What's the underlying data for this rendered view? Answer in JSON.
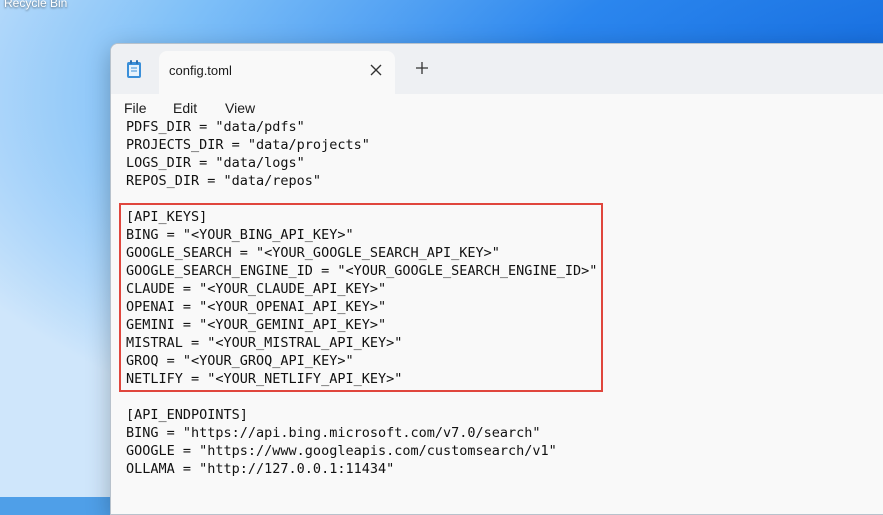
{
  "desktop": {
    "icon_label": "Recycle Bin"
  },
  "window": {
    "app_icon": "notepad-icon",
    "tab": {
      "title": "config.toml",
      "close_icon": "close-icon"
    },
    "new_tab_icon": "plus-icon"
  },
  "menu": {
    "file": "File",
    "edit": "Edit",
    "view": "View"
  },
  "editor": {
    "lines": [
      "PDFS_DIR = \"data/pdfs\"",
      "PROJECTS_DIR = \"data/projects\"",
      "LOGS_DIR = \"data/logs\"",
      "REPOS_DIR = \"data/repos\"",
      "",
      "[API_KEYS]",
      "BING = \"<YOUR_BING_API_KEY>\"",
      "GOOGLE_SEARCH = \"<YOUR_GOOGLE_SEARCH_API_KEY>\"",
      "GOOGLE_SEARCH_ENGINE_ID = \"<YOUR_GOOGLE_SEARCH_ENGINE_ID>\"",
      "CLAUDE = \"<YOUR_CLAUDE_API_KEY>\"",
      "OPENAI = \"<YOUR_OPENAI_API_KEY>\"",
      "GEMINI = \"<YOUR_GEMINI_API_KEY>\"",
      "MISTRAL = \"<YOUR_MISTRAL_API_KEY>\"",
      "GROQ = \"<YOUR_GROQ_API_KEY>\"",
      "NETLIFY = \"<YOUR_NETLIFY_API_KEY>\"",
      "",
      "[API_ENDPOINTS]",
      "BING = \"https://api.bing.microsoft.com/v7.0/search\"",
      "GOOGLE = \"https://www.googleapis.com/customsearch/v1\"",
      "OLLAMA = \"http://127.0.0.1:11434\""
    ],
    "highlight_color": "#e0463d"
  }
}
